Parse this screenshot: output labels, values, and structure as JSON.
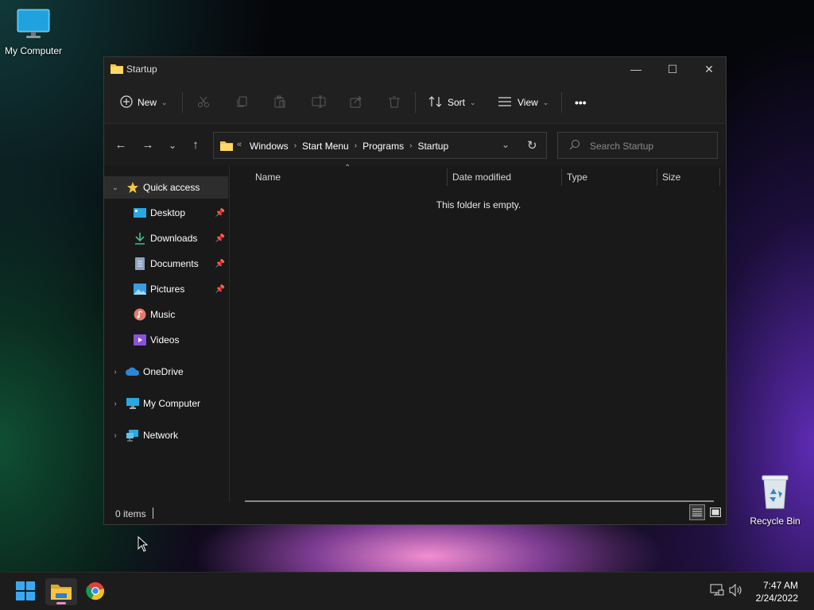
{
  "desktop": {
    "icons": [
      {
        "label": "My Computer",
        "icon": "monitor-icon"
      },
      {
        "label": "Recycle Bin",
        "icon": "recycle-bin-icon"
      }
    ]
  },
  "window": {
    "title": "Startup",
    "controls": {
      "minimize": "—",
      "maximize": "☐",
      "close": "✕"
    }
  },
  "toolbar": {
    "new_label": "New",
    "sort_label": "Sort",
    "view_label": "View",
    "more_label": "•••"
  },
  "address": {
    "breadcrumb_overflow": "«",
    "crumbs": [
      "Windows",
      "Start Menu",
      "Programs",
      "Startup"
    ],
    "separator": "›",
    "search_placeholder": "Search Startup"
  },
  "sidebar": {
    "items": [
      {
        "label": "Quick access",
        "icon": "star-icon"
      },
      {
        "label": "Desktop",
        "icon": "desktop-icon",
        "pinned": true
      },
      {
        "label": "Downloads",
        "icon": "download-icon",
        "pinned": true
      },
      {
        "label": "Documents",
        "icon": "documents-icon",
        "pinned": true
      },
      {
        "label": "Pictures",
        "icon": "pictures-icon",
        "pinned": true
      },
      {
        "label": "Music",
        "icon": "music-icon"
      },
      {
        "label": "Videos",
        "icon": "videos-icon"
      },
      {
        "label": "OneDrive",
        "icon": "cloud-icon"
      },
      {
        "label": "My Computer",
        "icon": "monitor-icon"
      },
      {
        "label": "Network",
        "icon": "network-icon"
      }
    ]
  },
  "content": {
    "columns": [
      "Name",
      "Date modified",
      "Type",
      "Size"
    ],
    "empty_message": "This folder is empty."
  },
  "status": {
    "item_count": "0 items"
  },
  "taskbar": {
    "clock_time": "7:47 AM",
    "clock_date": "2/24/2022"
  },
  "colors": {
    "accent": "#0078d4",
    "folder": "#f5c542",
    "indicator": "#e38cc8"
  }
}
